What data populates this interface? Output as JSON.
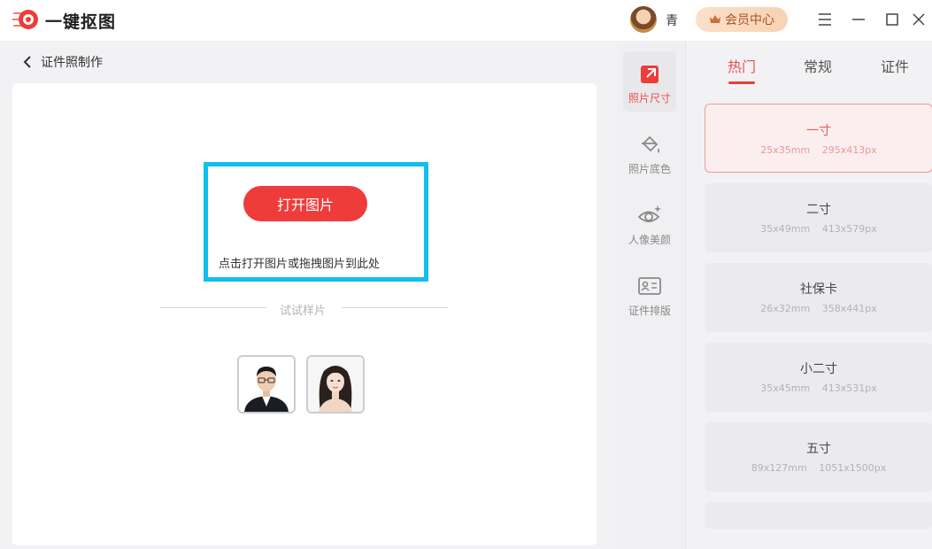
{
  "app": {
    "title": "一键抠图"
  },
  "header": {
    "username": "青",
    "vip_label": "会员中心",
    "icons": [
      "logo-icon",
      "avatar",
      "vip-crown-icon",
      "menu-icon",
      "minimize-icon",
      "maximize-icon",
      "close-icon"
    ]
  },
  "breadcrumb": {
    "back_label": "证件照制作"
  },
  "upload": {
    "open_label": "打开图片",
    "hint": "点击打开图片或拖拽图片到此处",
    "sample_divider": "试试样片"
  },
  "tools": [
    {
      "label": "照片尺寸",
      "icon": "photo-size-icon",
      "active": true
    },
    {
      "label": "照片底色",
      "icon": "paint-bucket-icon",
      "active": false
    },
    {
      "label": "人像美颜",
      "icon": "eye-sparkle-icon",
      "active": false
    },
    {
      "label": "证件排版",
      "icon": "id-card-icon",
      "active": false
    }
  ],
  "tabs": [
    {
      "label": "热门",
      "active": true
    },
    {
      "label": "常规",
      "active": false
    },
    {
      "label": "证件",
      "active": false
    }
  ],
  "sizes": [
    {
      "name": "一寸",
      "mm": "25x35mm",
      "px": "295x413px",
      "active": true
    },
    {
      "name": "二寸",
      "mm": "35x49mm",
      "px": "413x579px",
      "active": false
    },
    {
      "name": "社保卡",
      "mm": "26x32mm",
      "px": "358x441px",
      "active": false
    },
    {
      "name": "小二寸",
      "mm": "35x45mm",
      "px": "413x531px",
      "active": false
    },
    {
      "name": "五寸",
      "mm": "89x127mm",
      "px": "1051x1500px",
      "active": false
    }
  ],
  "colors": {
    "accent": "#ee3c3a",
    "highlight_box": "#10bff0",
    "vip_text": "#a2552a"
  }
}
